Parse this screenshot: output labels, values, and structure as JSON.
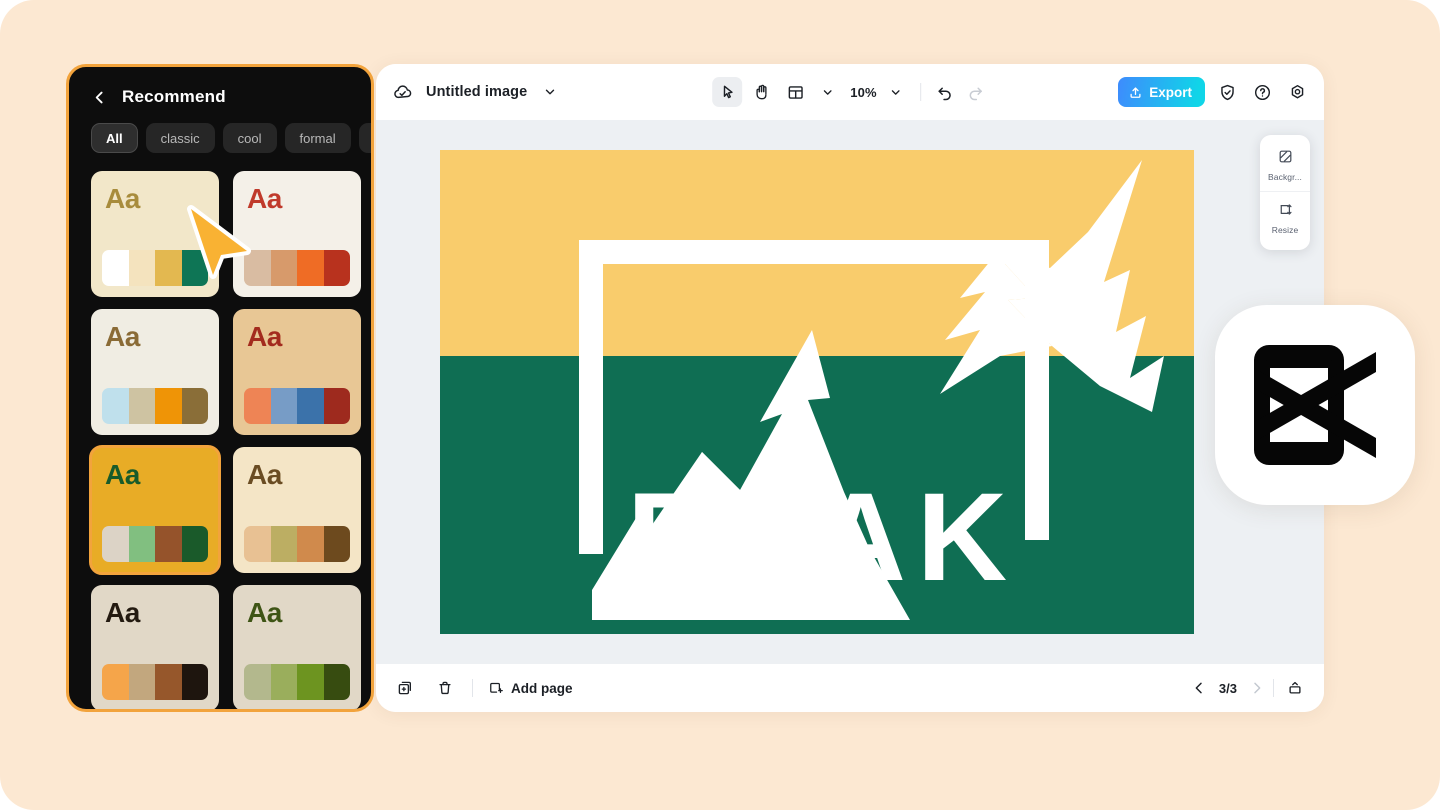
{
  "theme": {
    "page_bg": "#FCE8D2",
    "accent_orange": "#F2A33C",
    "sidebar_bg": "#0D0D0D",
    "canvas_bg": "#EDF0F3",
    "export_gradient_from": "#3E8BFD",
    "export_gradient_to": "#10D5E8"
  },
  "sidebar": {
    "back_icon": "chevron-left-icon",
    "title": "Recommend",
    "filters": [
      {
        "label": "All",
        "selected": true
      },
      {
        "label": "classic",
        "selected": false
      },
      {
        "label": "cool",
        "selected": false
      },
      {
        "label": "formal",
        "selected": false
      }
    ],
    "more_filters_icon": "chevron-down-icon",
    "palettes": [
      {
        "sample_text": "Aa",
        "card_bg": "#F2E7C9",
        "text_color": "#A88C3C",
        "selected": false,
        "swatches": [
          "#FFFFFF",
          "#F4E3BE",
          "#E3B850",
          "#0E7555"
        ]
      },
      {
        "sample_text": "Aa",
        "card_bg": "#F4F0E8",
        "text_color": "#C03A2B",
        "selected": false,
        "swatches": [
          "#D9BCA2",
          "#D79A6B",
          "#EF6C25",
          "#B8321E"
        ]
      },
      {
        "sample_text": "Aa",
        "card_bg": "#F0EDE3",
        "text_color": "#8A6B36",
        "selected": false,
        "swatches": [
          "#BFE0EC",
          "#CEC3A2",
          "#EF9406",
          "#8A6E38"
        ]
      },
      {
        "sample_text": "Aa",
        "card_bg": "#E8C795",
        "text_color": "#A32B1E",
        "selected": false,
        "swatches": [
          "#EE8455",
          "#779CC6",
          "#3B72AA",
          "#9E2A1E"
        ]
      },
      {
        "sample_text": "Aa",
        "card_bg": "#E8AC26",
        "text_color": "#185B2A",
        "selected": true,
        "swatches": [
          "#DCD3C6",
          "#81BF80",
          "#95532B",
          "#1A5A2A"
        ]
      },
      {
        "sample_text": "Aa",
        "card_bg": "#F4E5C6",
        "text_color": "#6A4C23",
        "selected": false,
        "swatches": [
          "#E8C193",
          "#BCAE63",
          "#D08A4C",
          "#6D4A1E"
        ]
      },
      {
        "sample_text": "Aa",
        "card_bg": "#E1D8C7",
        "text_color": "#231A10",
        "selected": false,
        "swatches": [
          "#F5A54A",
          "#C2A77E",
          "#96572B",
          "#1E150E"
        ]
      },
      {
        "sample_text": "Aa",
        "card_bg": "#E1D8C7",
        "text_color": "#3E5415",
        "selected": false,
        "swatches": [
          "#B3B88D",
          "#9AAE5C",
          "#6D9420",
          "#374C10"
        ]
      }
    ]
  },
  "editor": {
    "topbar": {
      "cloud_icon": "cloud-check-icon",
      "document_title": "Untitled image",
      "title_dropdown_icon": "chevron-down-icon",
      "tools": [
        {
          "name": "select-tool",
          "icon": "cursor-arrow-icon",
          "active": true
        },
        {
          "name": "hand-tool",
          "icon": "hand-icon",
          "active": false
        },
        {
          "name": "layout-tool",
          "icon": "layout-grid-icon",
          "active": false
        }
      ],
      "layout_dropdown_icon": "chevron-down-icon",
      "zoom_level": "10%",
      "zoom_dropdown_icon": "chevron-down-icon",
      "undo_icon": "undo-arrow-icon",
      "redo_icon": "redo-arrow-icon",
      "redo_disabled": true,
      "export_label": "Export",
      "export_icon": "upload-icon",
      "right_icons": [
        {
          "name": "shield-check-icon"
        },
        {
          "name": "help-circle-icon"
        },
        {
          "name": "settings-gear-icon"
        }
      ]
    },
    "side_panel": [
      {
        "icon": "background-image-icon",
        "label": "Backgr..."
      },
      {
        "icon": "resize-frame-icon",
        "label": "Resize"
      }
    ],
    "artboard": {
      "sky_color": "#F9CC6C",
      "ground_color": "#0F6E53",
      "graphic_color": "#FFFFFF",
      "headline": "PEAK",
      "graphic_name": "mountain-range-line-art"
    },
    "bottombar": {
      "duplicate_icon": "duplicate-page-icon",
      "delete_icon": "trash-icon",
      "add_page_icon": "add-page-icon",
      "add_page_label": "Add page",
      "prev_page_icon": "chevron-left-icon",
      "page_indicator": "3/3",
      "next_page_icon": "chevron-right-icon",
      "next_page_disabled": true,
      "expand_icon": "expand-panel-icon"
    }
  },
  "overlay": {
    "cursor_icon": "pointer-arrow-cursor",
    "cursor_fill": "#F9B233",
    "brand_logo": "capcut-logo"
  }
}
